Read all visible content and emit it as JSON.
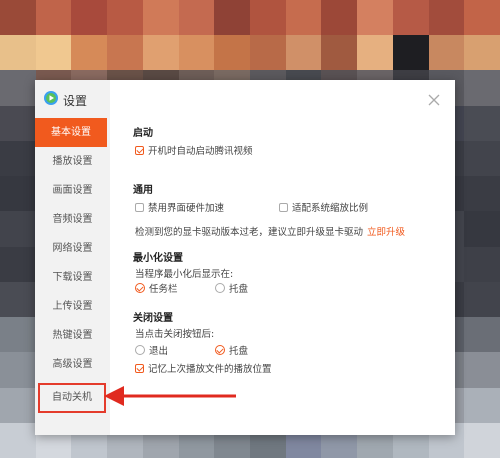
{
  "background": {
    "colors": [
      "#9a4a38",
      "#c0644a",
      "#a84a3c",
      "#b85a44",
      "#d07a58",
      "#c46a50",
      "#8f4236",
      "#b0543f",
      "#c66c4e",
      "#9c4838",
      "#d48060",
      "#b65a46",
      "#a24c3c",
      "#c26448",
      "#e8c08a",
      "#f0c890",
      "#d68a58",
      "#c87650",
      "#e0a070",
      "#d89060",
      "#c47448",
      "#b86a48",
      "#d09068",
      "#a05a40",
      "#e6b080",
      "#1e1e22",
      "#c88860",
      "#d8a070",
      "#6a6a70",
      "#7a5a50",
      "#8a6a60",
      "#6a5248",
      "#5a4a44",
      "#6e5e58",
      "#7a6a62",
      "#5c5a5e",
      "#484a50",
      "#5a5254",
      "#6a6466",
      "#3e3e44",
      "#5a5a60",
      "#6a6a70",
      "#4a4a52",
      "#3a3c44",
      "#44464e",
      "#50525a",
      "#3a3c44",
      "#44464e",
      "#4a4c54",
      "#3e4048",
      "#363840",
      "#3e4048",
      "#4a4c54",
      "#3a3c44",
      "#424450",
      "#4a4c54",
      "#3a3c44",
      "#42444c",
      "#363840",
      "#3a3c44",
      "#42444c",
      "#3a3c44",
      "#363840",
      "#3e4048",
      "#42444c",
      "#3a3c44",
      "#363840",
      "#42444c",
      "#3a3c44",
      "#42444c",
      "#363840",
      "#3e4048",
      "#42444c",
      "#3a3c44",
      "#363840",
      "#42444c",
      "#3a3c44",
      "#3e4048",
      "#363840",
      "#3a3c44",
      "#42444c",
      "#3e4048",
      "#363840",
      "#3a3c44",
      "#42444c",
      "#3a3c44",
      "#363840",
      "#42444c",
      "#3a3c44",
      "#3e4048",
      "#42444c",
      "#363840",
      "#3a3c44",
      "#42444c",
      "#3e4048",
      "#3a3c44",
      "#42444c",
      "#363840",
      "#3a3c44",
      "#42444c",
      "#3e4048",
      "#363840",
      "#3a3c44",
      "#42444c",
      "#363840",
      "#3a3c44",
      "#3e4048",
      "#42444c",
      "#363840",
      "#3a3c44",
      "#42444c",
      "#3e4048",
      "#4a4c54",
      "#3a3c44",
      "#42444c",
      "#3e4048",
      "#363840",
      "#3a3c44",
      "#42444c",
      "#363840",
      "#3a3c44",
      "#42444c",
      "#3e4048",
      "#363840",
      "#3a3c44",
      "#42444c",
      "#7a8088",
      "#6a7078",
      "#5a6068",
      "#4a5058",
      "#42444c",
      "#3a3c44",
      "#42444c",
      "#3e4048",
      "#363840",
      "#3a3c44",
      "#42444c",
      "#4a4c54",
      "#5a5e66",
      "#6a6e76",
      "#8a9098",
      "#9aa0a8",
      "#7a8088",
      "#6a7078",
      "#5a6068",
      "#4a5058",
      "#42444c",
      "#3e4048",
      "#42444c",
      "#4a4c54",
      "#5a5e66",
      "#6a6e76",
      "#7a7e86",
      "#8a8e96",
      "#a0a6ae",
      "#b0b6be",
      "#9aa0a8",
      "#8a9098",
      "#7a8088",
      "#6a7078",
      "#5a6068",
      "#4a5058",
      "#5a5e66",
      "#6a6e76",
      "#7a7e86",
      "#8a8e96",
      "#9a9ea6",
      "#aab0b8",
      "#c8cdd4",
      "#d4d8de",
      "#c0c6ce",
      "#b0b6be",
      "#a0a6ae",
      "#9098a0",
      "#808890",
      "#707880",
      "#8088a0",
      "#9098a8",
      "#a0a8b0",
      "#b0b8c0",
      "#c0c6ce",
      "#d0d4da"
    ]
  },
  "dialog": {
    "title": "设置",
    "logo_icon": "tencent-video-logo-icon",
    "accent": "#f15a1e",
    "nav": [
      {
        "label": "基本设置",
        "active": true
      },
      {
        "label": "播放设置",
        "active": false
      },
      {
        "label": "画面设置",
        "active": false
      },
      {
        "label": "音频设置",
        "active": false
      },
      {
        "label": "网络设置",
        "active": false
      },
      {
        "label": "下载设置",
        "active": false
      },
      {
        "label": "上传设置",
        "active": false
      },
      {
        "label": "热键设置",
        "active": false
      },
      {
        "label": "高级设置",
        "active": false
      },
      {
        "label": "自动关机",
        "active": false,
        "highlighted": true
      }
    ],
    "sections": {
      "startup": {
        "title": "启动",
        "autostart": {
          "label": "开机时自动启动腾讯视频",
          "checked": true
        }
      },
      "general": {
        "title": "通用",
        "disable_hw": {
          "label": "禁用界面硬件加速",
          "checked": false
        },
        "adapt_scale": {
          "label": "适配系统缩放比例",
          "checked": false
        },
        "driver_notice": "检测到您的显卡驱动版本过老，建议立即升级显卡驱动",
        "upgrade_link": "立即升级"
      },
      "minimize": {
        "title": "最小化设置",
        "prompt": "当程序最小化后显示在:",
        "taskbar": {
          "label": "任务栏",
          "selected": true
        },
        "tray": {
          "label": "托盘",
          "selected": false
        }
      },
      "close": {
        "title": "关闭设置",
        "prompt": "当点击关闭按钮后:",
        "exit": {
          "label": "退出",
          "selected": false
        },
        "tray": {
          "label": "托盘",
          "selected": true
        },
        "remember": {
          "label": "记忆上次播放文件的播放位置",
          "checked": true
        }
      }
    }
  },
  "annotation": {
    "color": "#e02a1f"
  }
}
